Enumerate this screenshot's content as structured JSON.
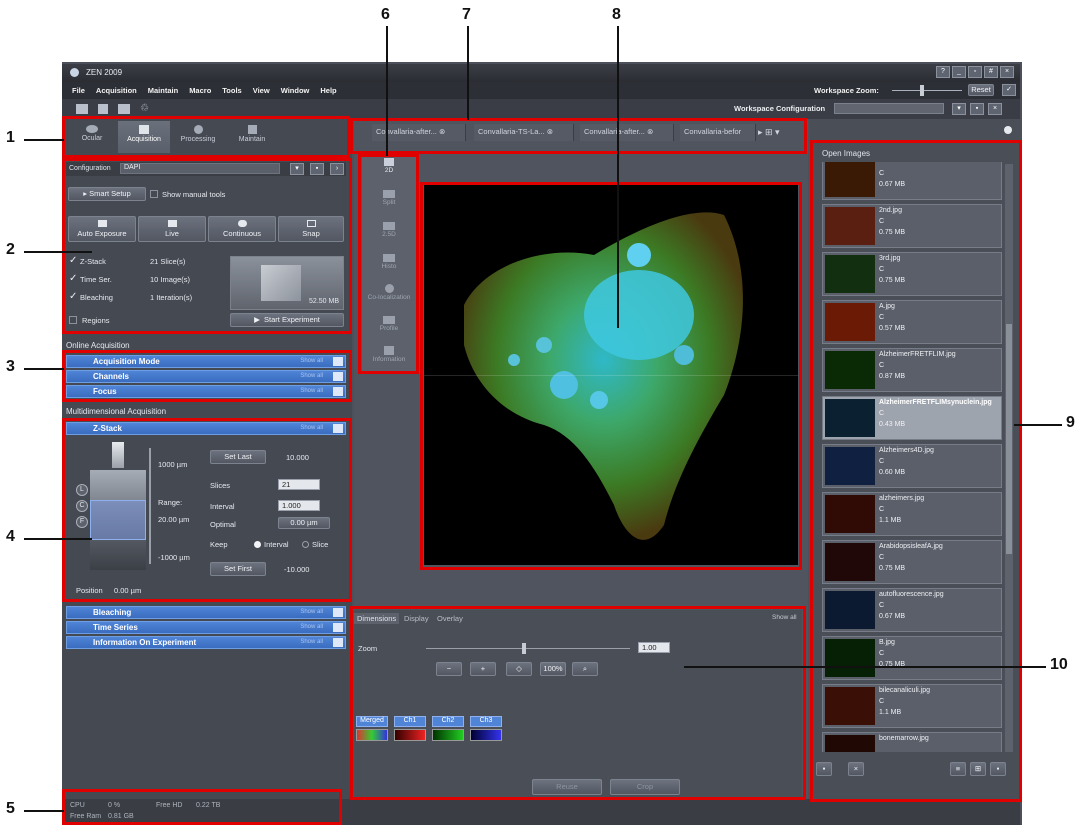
{
  "window": {
    "title": "ZEN 2009",
    "workspace_zoom_label": "Workspace Zoom:",
    "reset_label": "Reset",
    "workspace_config_label": "Workspace Configuration"
  },
  "menu": [
    "File",
    "Acquisition",
    "Maintain",
    "Macro",
    "Tools",
    "View",
    "Window",
    "Help"
  ],
  "tabs": [
    "Ocular",
    "Acquisition",
    "Processing",
    "Maintain"
  ],
  "config": {
    "label": "Configuration",
    "value": "DAPI"
  },
  "smart_setup": "Smart Setup",
  "show_manual_tools": "Show manual tools",
  "action_buttons": [
    "Auto Exposure",
    "Live",
    "Continuous",
    "Snap"
  ],
  "experiment": {
    "rows": [
      {
        "label": "Z-Stack",
        "value": "21 Slice(s)"
      },
      {
        "label": "Time Ser.",
        "value": "10 Image(s)"
      },
      {
        "label": "Bleaching",
        "value": "1 Iteration(s)"
      }
    ],
    "regions_label": "Regions",
    "size": "52.50 MB",
    "start_label": "Start Experiment"
  },
  "online_acquisition": {
    "title": "Online Acquisition",
    "bars": [
      "Acquisition Mode",
      "Channels",
      "Focus"
    ],
    "show_all": "Show all"
  },
  "multidim": {
    "title": "Multidimensional Acquisition",
    "bar": "Z-Stack"
  },
  "zstack": {
    "top_um": "1000 µm",
    "range_label": "Range:",
    "range_val": "20.00 µm",
    "bottom_um": "-1000 µm",
    "set_last": "Set Last",
    "last_val": "10.000",
    "slices_label": "Slices",
    "slices_val": "21",
    "interval_label": "Interval",
    "interval_val": "1.000",
    "optimal_label": "Optimal",
    "optimal_val": "0.00 µm",
    "keep_label": "Keep",
    "keep_interval": "Interval",
    "keep_slice": "Slice",
    "set_first": "Set First",
    "first_val": "-10.000",
    "position_label": "Position",
    "position_val": "0.00 µm",
    "markers": [
      "L",
      "C",
      "F"
    ]
  },
  "lower_bars": [
    "Bleaching",
    "Time Series",
    "Information On Experiment"
  ],
  "status": {
    "cpu_label": "CPU",
    "cpu_val": "0 %",
    "freehd_label": "Free HD",
    "freehd_val": "0.22 TB",
    "freeram_label": "Free Ram",
    "freeram_val": "0.81 GB"
  },
  "image_tabs": [
    "Convallaria-after...",
    "Convallaria-TS-La...",
    "Convallaria-after...",
    "Convallaria-befor"
  ],
  "view_tools": [
    "2D",
    "Split",
    "2.5D",
    "Histo",
    "Co-localization",
    "Profile",
    "Information"
  ],
  "bottom_panel": {
    "tabs": [
      "Dimensions",
      "Display",
      "Overlay"
    ],
    "show_all": "Show all",
    "zoom_label": "Zoom",
    "zoom_val": "1.00",
    "zoom_buttons": [
      "-",
      "+",
      "fit",
      "100%",
      "search"
    ],
    "channels": [
      "Merged",
      "Ch1",
      "Ch2",
      "Ch3"
    ],
    "reuse_label": "Reuse",
    "crop_label": "Crop"
  },
  "open_images": {
    "title": "Open Images",
    "items": [
      {
        "name": "",
        "type": "C",
        "size": "0.67 MB"
      },
      {
        "name": "2nd.jpg",
        "type": "C",
        "size": "0.75 MB"
      },
      {
        "name": "3rd.jpg",
        "type": "C",
        "size": "0.75 MB"
      },
      {
        "name": "A.jpg",
        "type": "C",
        "size": "0.57 MB"
      },
      {
        "name": "AlzheimerFRETFLIM.jpg",
        "type": "C",
        "size": "0.87 MB"
      },
      {
        "name": "AlzheimerFRETFLIMsynuclein.jpg",
        "type": "C",
        "size": "0.43 MB"
      },
      {
        "name": "Alzheimers4D.jpg",
        "type": "C",
        "size": "0.60 MB"
      },
      {
        "name": "alzheimers.jpg",
        "type": "C",
        "size": "1.1 MB"
      },
      {
        "name": "ArabidopsisleafA.jpg",
        "type": "C",
        "size": "0.75 MB"
      },
      {
        "name": "autofluorescence.jpg",
        "type": "C",
        "size": "0.67 MB"
      },
      {
        "name": "B.jpg",
        "type": "C",
        "size": "0.75 MB"
      },
      {
        "name": "bilecanaliculi.jpg",
        "type": "C",
        "size": "1.1 MB"
      },
      {
        "name": "bonemarrow.jpg",
        "type": "",
        "size": ""
      }
    ]
  },
  "annotations": [
    "1",
    "2",
    "3",
    "4",
    "5",
    "6",
    "7",
    "8",
    "9",
    "10"
  ],
  "colors": {
    "highlight": "#e00000",
    "accent_blue": "#4f84d6"
  }
}
